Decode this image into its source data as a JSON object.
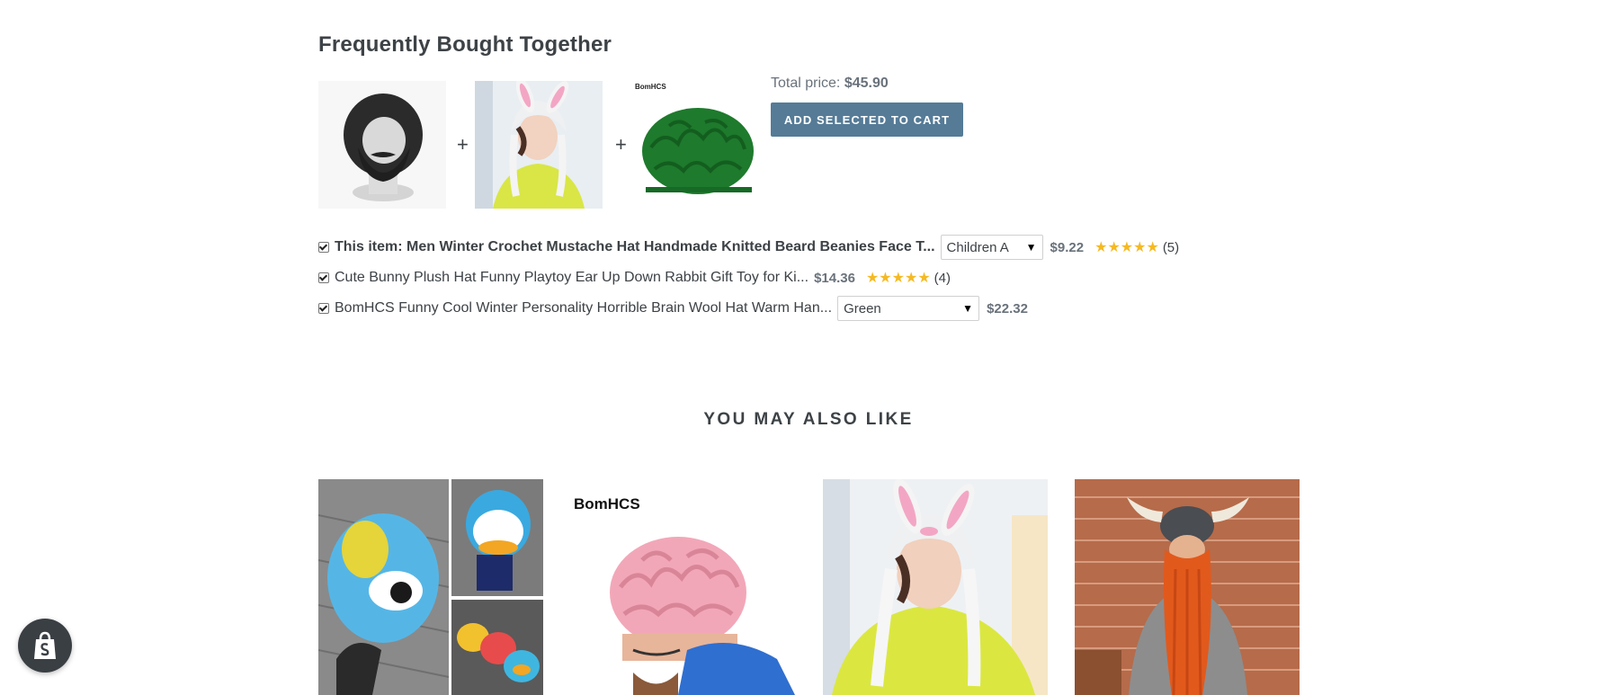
{
  "fbt": {
    "title": "Frequently Bought Together",
    "total_label": "Total price:",
    "total_value": "$45.90",
    "add_button": "ADD SELECTED TO CART",
    "images": [
      "beard-hat-thumbnail",
      "bunny-hat-thumbnail",
      "brain-hat-thumbnail"
    ],
    "plus": "+",
    "brand_text": "BomHCS",
    "items": [
      {
        "title": "This item: Men Winter Crochet Mustache Hat Handmade Knitted Beard Beanies Face T...",
        "variant": "Children A",
        "price": "$9.22",
        "stars": "★★★★★",
        "reviews": "(5)"
      },
      {
        "title": "Cute Bunny Plush Hat Funny Playtoy Ear Up Down Rabbit Gift Toy for Ki...",
        "price": "$14.36",
        "stars": "★★★★★",
        "reviews": "(4)"
      },
      {
        "title": "BomHCS Funny Cool Winter Personality Horrible Brain Wool Hat Warm Han...",
        "variant": "Green",
        "price": "$22.32"
      }
    ]
  },
  "recommendations": {
    "heading": "YOU MAY ALSO LIKE",
    "products": [
      {
        "image": "donald-duck-hat-image"
      },
      {
        "image": "pink-brain-hat-image",
        "brand_text": "BomHCS"
      },
      {
        "image": "bunny-hat-image"
      },
      {
        "image": "viking-beard-hat-image"
      }
    ]
  },
  "colors": {
    "accent_button": "#557b97",
    "text": "#3d4246",
    "muted": "#69727b",
    "star": "#f5b923",
    "badge": "#3a3f44"
  },
  "icons": {
    "checkbox": "checkbox-checked-icon",
    "caret": "caret-down-icon",
    "shopify": "shopify-bag-icon"
  }
}
